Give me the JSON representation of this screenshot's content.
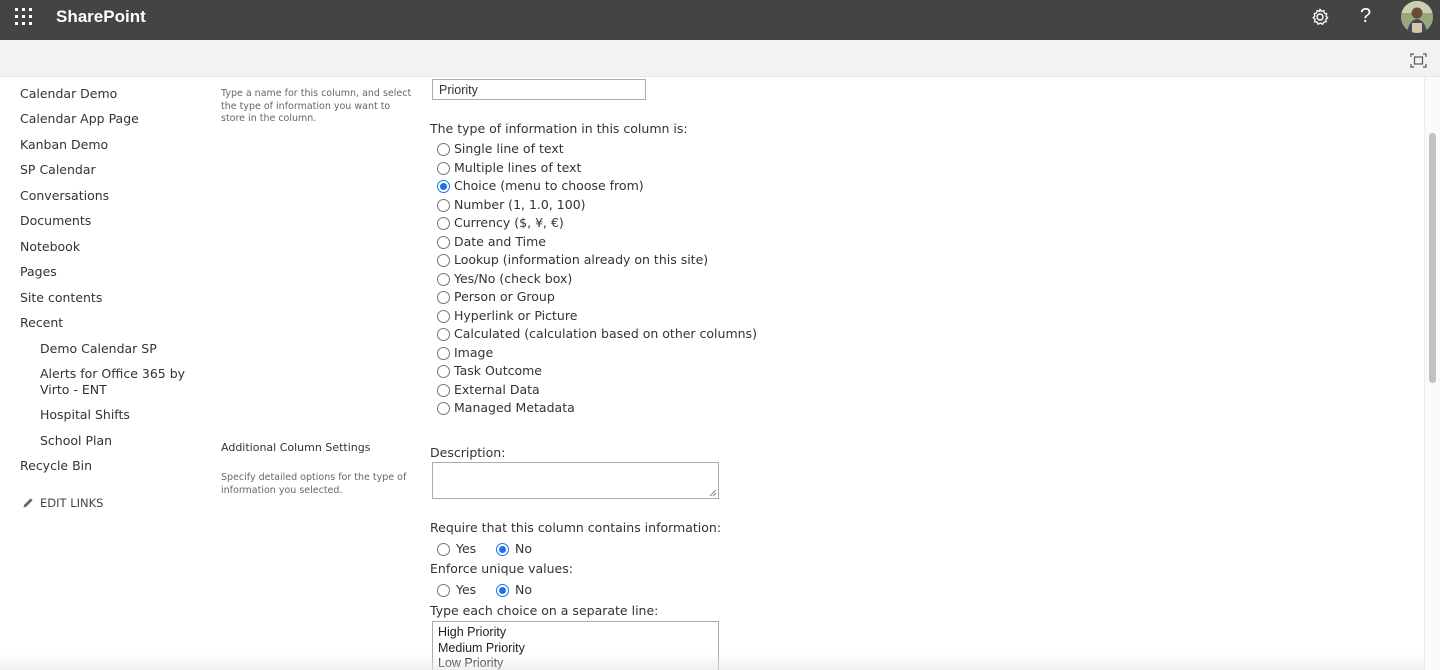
{
  "suite_bar": {
    "app_title": "SharePoint",
    "waffle_icon": "app-launcher-icon",
    "settings_icon": "gear-icon",
    "help_label": "?",
    "avatar_icon": "user-avatar"
  },
  "ribbon": {
    "focus_icon": "focus-mode-icon"
  },
  "left_nav": {
    "items": [
      {
        "label": "Calendar Demo"
      },
      {
        "label": "Calendar App Page"
      },
      {
        "label": "Kanban Demo"
      },
      {
        "label": "SP Calendar"
      },
      {
        "label": "Conversations"
      },
      {
        "label": "Documents"
      },
      {
        "label": "Notebook"
      },
      {
        "label": "Pages"
      },
      {
        "label": "Site contents"
      },
      {
        "label": "Recent"
      }
    ],
    "recent": [
      {
        "label": "Demo Calendar SP"
      },
      {
        "label": "Alerts for Office 365 by Virto - ENT"
      },
      {
        "label": "Hospital Shifts"
      },
      {
        "label": "School Plan"
      }
    ],
    "recycle_bin": "Recycle Bin",
    "edit_links": "EDIT LINKS"
  },
  "name_section": {
    "description": "Type a name for this column, and select the type of information you want to store in the column.",
    "column_name_value": "Priority",
    "type_label": "The type of information in this column is:",
    "types": [
      {
        "label": "Single line of text",
        "checked": false
      },
      {
        "label": "Multiple lines of text",
        "checked": false
      },
      {
        "label": "Choice (menu to choose from)",
        "checked": true
      },
      {
        "label": "Number (1, 1.0, 100)",
        "checked": false
      },
      {
        "label": "Currency ($, ¥, €)",
        "checked": false
      },
      {
        "label": "Date and Time",
        "checked": false
      },
      {
        "label": "Lookup (information already on this site)",
        "checked": false
      },
      {
        "label": "Yes/No (check box)",
        "checked": false
      },
      {
        "label": "Person or Group",
        "checked": false
      },
      {
        "label": "Hyperlink or Picture",
        "checked": false
      },
      {
        "label": "Calculated (calculation based on other columns)",
        "checked": false
      },
      {
        "label": "Image",
        "checked": false
      },
      {
        "label": "Task Outcome",
        "checked": false
      },
      {
        "label": "External Data",
        "checked": false
      },
      {
        "label": "Managed Metadata",
        "checked": false
      }
    ]
  },
  "additional_section": {
    "title": "Additional Column Settings",
    "description": "Specify detailed options for the type of information you selected.",
    "description_label": "Description:",
    "require_label": "Require that this column contains information:",
    "require_yes": "Yes",
    "require_no": "No",
    "require_value": "No",
    "unique_label": "Enforce unique values:",
    "unique_yes": "Yes",
    "unique_no": "No",
    "unique_value": "No",
    "choices_label": "Type each choice on a separate line:",
    "choices": [
      "High Priority",
      "Medium Priority",
      "Low Priority"
    ]
  },
  "colors": {
    "suite_bar_bg": "#444444",
    "ribbon_bg": "#f2f2f2",
    "radio_selected": "#1a73e8",
    "text": "#333333"
  }
}
